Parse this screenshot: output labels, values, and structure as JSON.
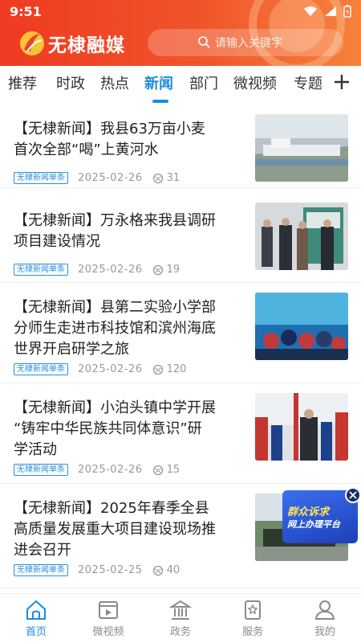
{
  "status": {
    "time": "9:51"
  },
  "header": {
    "app_name": "无棣融媒",
    "search_placeholder": "请输入关键字"
  },
  "tabs": [
    {
      "label": "推荐"
    },
    {
      "label": "时政"
    },
    {
      "label": "热点"
    },
    {
      "label": "新闻",
      "active": true
    },
    {
      "label": "部门"
    },
    {
      "label": "微视频"
    },
    {
      "label": "专题"
    }
  ],
  "news": [
    {
      "title_l1": "【无棣新闻】我县63万亩小麦",
      "title_l2": "首次全部“喝”上黄河水",
      "title_l3": "",
      "badge": "无棣新闻单条",
      "date": "2025-02-26",
      "views": "31"
    },
    {
      "title_l1": "【无棣新闻】万永格来我县调研",
      "title_l2": "项目建设情况",
      "title_l3": "",
      "badge": "无棣新闻单条",
      "date": "2025-02-26",
      "views": "19"
    },
    {
      "title_l1": "【无棣新闻】县第二实验小学部",
      "title_l2": "分师生走进市科技馆和滨州海底",
      "title_l3": "世界开启研学之旅",
      "badge": "无棣新闻单条",
      "date": "2025-02-26",
      "views": "120"
    },
    {
      "title_l1": "【无棣新闻】小泊头镇中学开展",
      "title_l2": "“铸牢中华民族共同体意识”研",
      "title_l3": "学活动",
      "badge": "无棣新闻单条",
      "date": "2025-02-26",
      "views": "15"
    },
    {
      "title_l1": "【无棣新闻】2025年春季全县",
      "title_l2": "高质量发展重大项目建设现场推",
      "title_l3": "进会召开",
      "badge": "无棣新闻单条",
      "date": "2025-02-25",
      "views": "40"
    }
  ],
  "float_ad": {
    "line1": "群众诉求",
    "line2": "网上办理平台"
  },
  "bottom_nav": [
    {
      "label": "首页",
      "icon": "home-icon",
      "active": true
    },
    {
      "label": "微视频",
      "icon": "video-icon"
    },
    {
      "label": "政务",
      "icon": "government-icon"
    },
    {
      "label": "服务",
      "icon": "service-icon"
    },
    {
      "label": "我的",
      "icon": "profile-icon"
    }
  ],
  "colors": {
    "header_start": "#ef3a22",
    "header_end": "#f7823b",
    "accent": "#1b8de0"
  }
}
